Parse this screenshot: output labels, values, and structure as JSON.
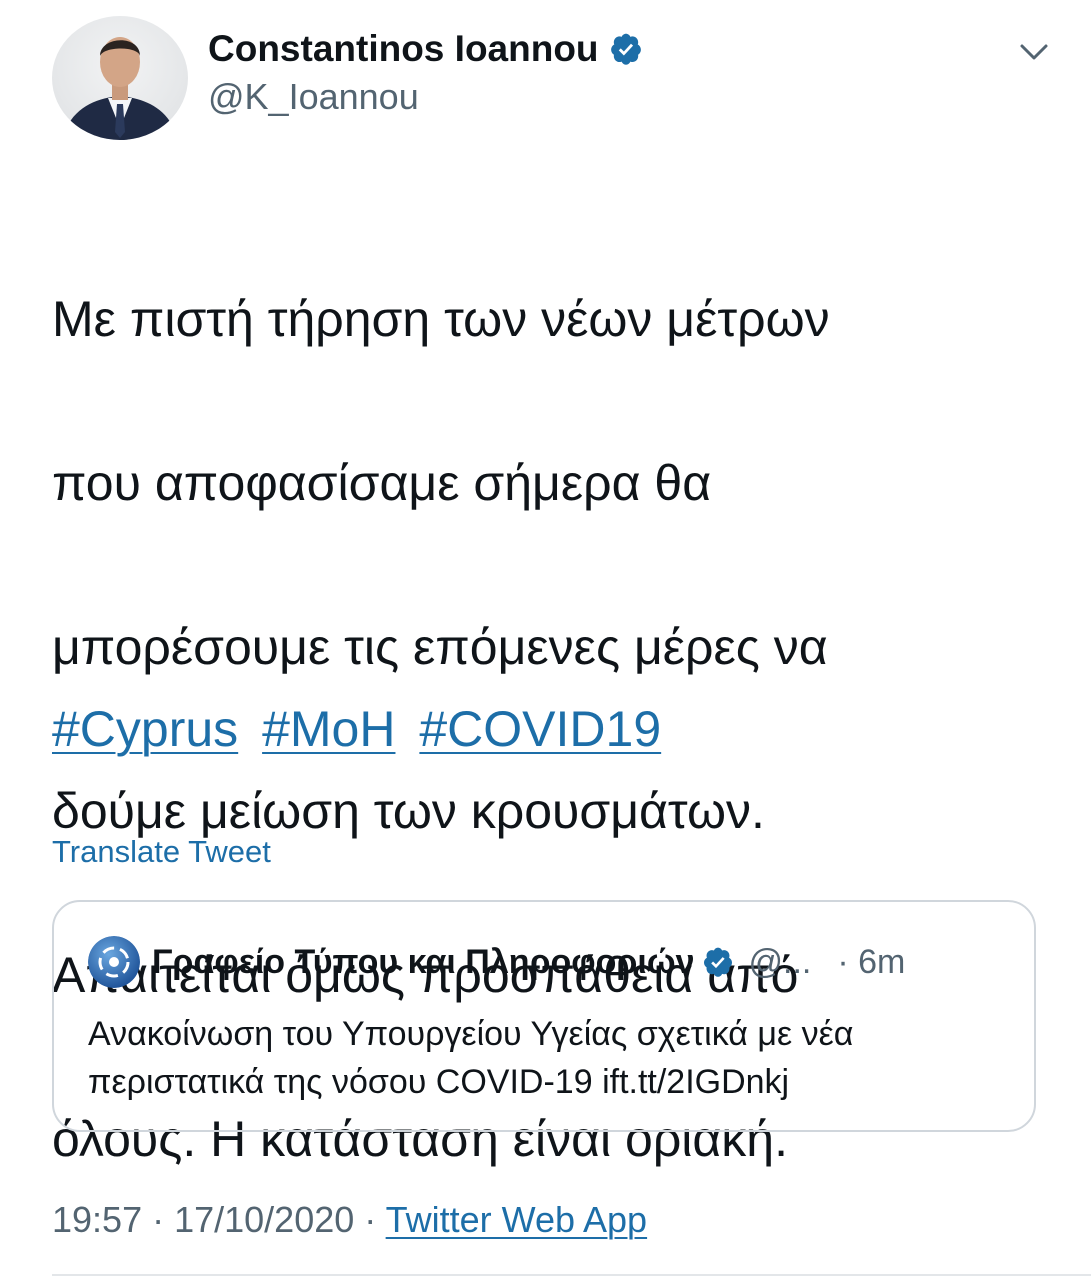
{
  "author": {
    "name": "Constantinos Ioannou",
    "handle": "@K_Ioannou",
    "verified": true
  },
  "tweet": {
    "lines": [
      "Με πιστή τήρηση των νέων μέτρων",
      "που αποφασίσαμε σήμερα θα",
      "μπορέσουμε τις επόμενες μέρες να",
      "δούμε μείωση των κρουσμάτων.",
      "Απαιτείται όμως προσπάθεια από",
      "όλους. Η κατάσταση είναι οριακή."
    ],
    "hashtags": [
      "#Cyprus",
      "#MoH",
      "#COVID19"
    ]
  },
  "translate_label": "Translate Tweet",
  "quoted": {
    "name": "Γραφείο Τύπου και Πληροφοριών",
    "handle": "@...",
    "time": "· 6m",
    "body": "Ανακοίνωση του Υπουργείου Υγείας σχετικά με νέα περιστατικά της νόσου COVID-19 ",
    "link": "ift.tt/2IGDnkj"
  },
  "meta": {
    "time": "19:57",
    "sep1": " · ",
    "date": "17/10/2020",
    "sep2": " · ",
    "app": "Twitter Web App"
  },
  "colors": {
    "link": "#1d6ea8",
    "secondary_text": "#536471",
    "verified": "#1d6ea8"
  }
}
